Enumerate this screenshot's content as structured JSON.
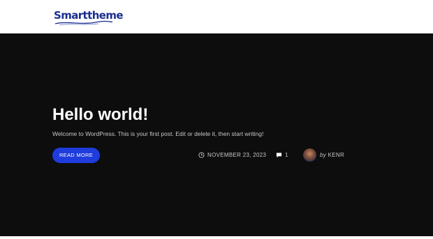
{
  "header": {
    "logo_text": "Smarttheme"
  },
  "post": {
    "title": "Hello world!",
    "excerpt": "Welcome to WordPress. This is your first post. Edit or delete it, then start writing!",
    "read_more_label": "READ MORE",
    "date": "NOVEMBER 23, 2023",
    "comment_count": "1",
    "author_prefix": "by",
    "author_name": "KENR"
  },
  "colors": {
    "brand_blue": "#1a2f8f",
    "button_blue": "#1f3cdc",
    "hero_background": "#0d0d0d"
  },
  "icons": {
    "date": "clock-icon",
    "comments": "comment-icon"
  }
}
